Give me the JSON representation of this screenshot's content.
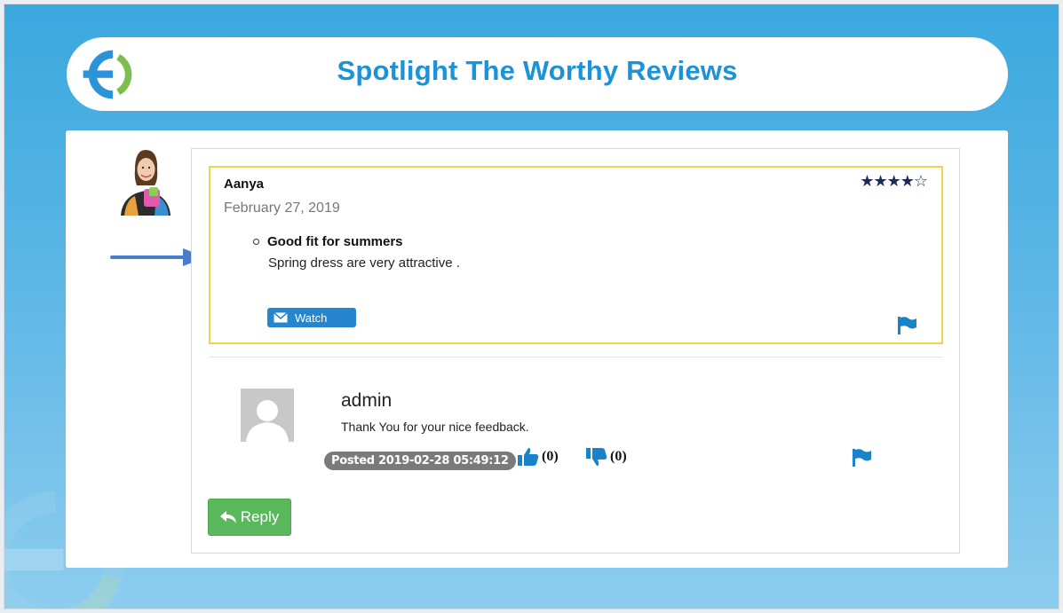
{
  "banner": {
    "title": "Spotlight The Worthy Reviews"
  },
  "review": {
    "author": "Aanya",
    "date": "February 27, 2019",
    "rating": {
      "value": 4,
      "max": 5,
      "filled_stars": "★★★★",
      "empty_stars": "☆"
    },
    "title": "Good fit for summers",
    "body": "Spring dress are very attractive .",
    "watch_label": "Watch"
  },
  "reply": {
    "author": "admin",
    "text": "Thank You for your nice feedback.",
    "posted": "Posted 2019-02-28 05:49:12",
    "upvotes": "(0)",
    "downvotes": "(0)"
  },
  "actions": {
    "reply_label": "Reply"
  },
  "icons": {
    "logo": "brand-logo-icon",
    "arrow": "right-arrow-icon",
    "watch": "envelope-icon",
    "flag": "flag-icon",
    "thumbs_up": "thumbs-up-icon",
    "thumbs_down": "thumbs-down-icon",
    "reply": "reply-arrow-icon"
  },
  "colors": {
    "accent": "#1c93d6",
    "highlight_border": "#f0d54c",
    "star": "#1f2b57",
    "watch_button": "#2585cf",
    "reply_button": "#5bb75b",
    "flag": "#1a82c8"
  }
}
